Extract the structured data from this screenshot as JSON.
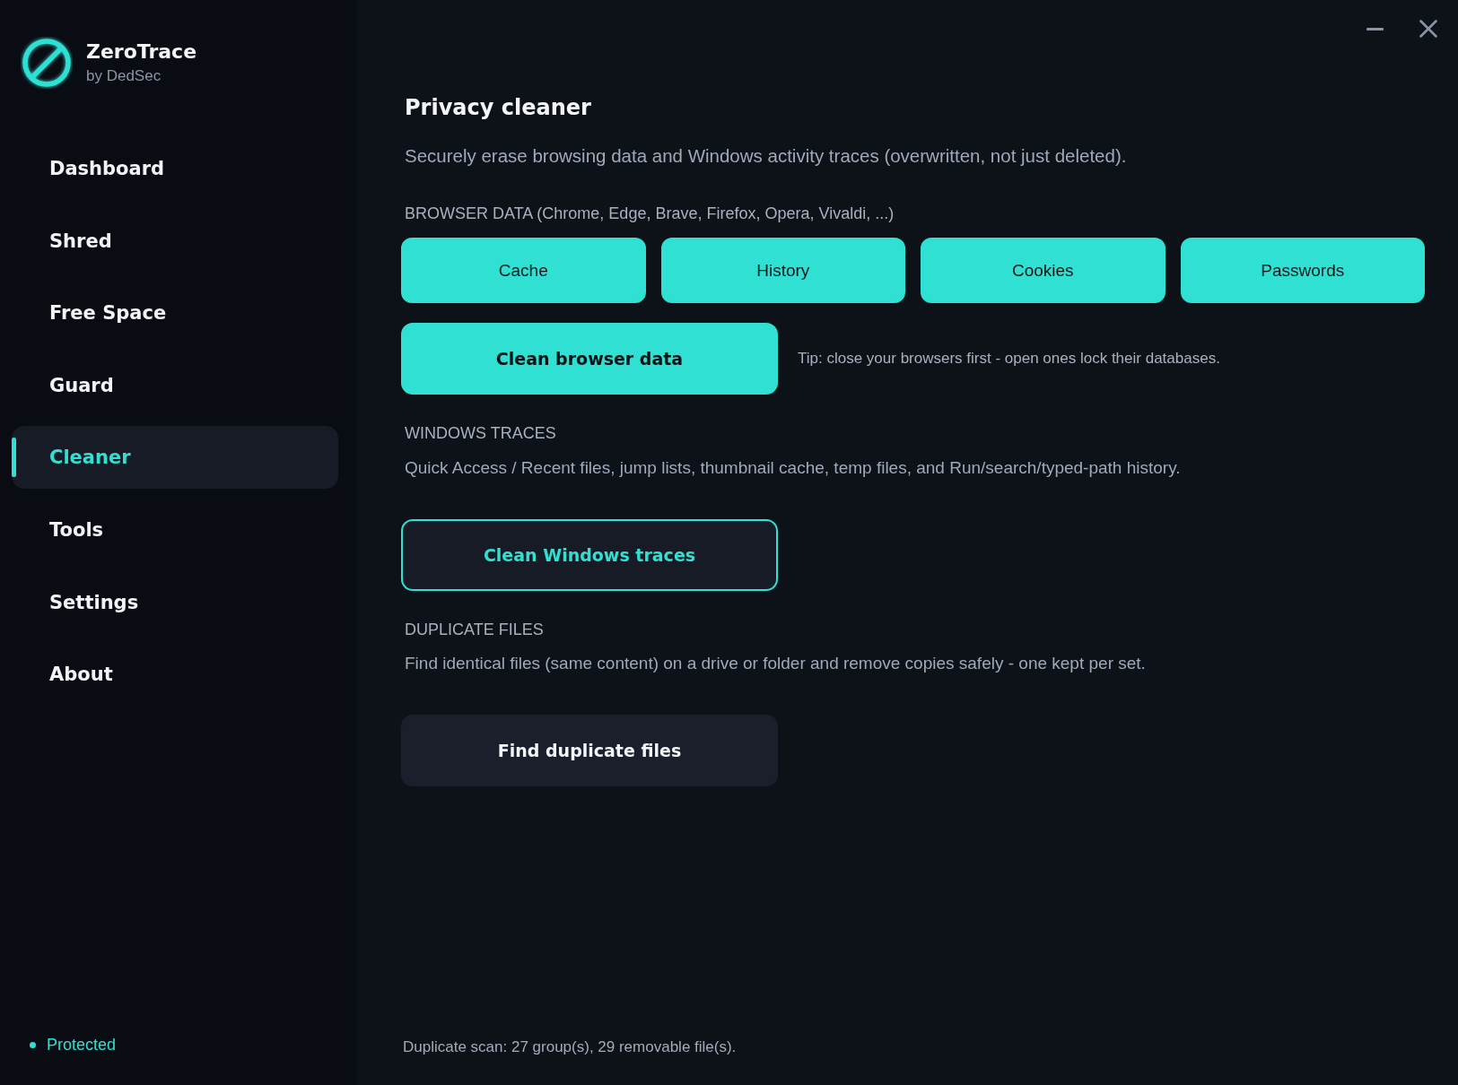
{
  "app": {
    "name": "ZeroTrace",
    "byline": "by DedSec"
  },
  "sidebar": {
    "items": [
      {
        "label": "Dashboard",
        "selected": false
      },
      {
        "label": "Shred",
        "selected": false
      },
      {
        "label": "Free Space",
        "selected": false
      },
      {
        "label": "Guard",
        "selected": false
      },
      {
        "label": "Cleaner",
        "selected": true
      },
      {
        "label": "Tools",
        "selected": false
      },
      {
        "label": "Settings",
        "selected": false
      },
      {
        "label": "About",
        "selected": false
      }
    ],
    "status": "Protected"
  },
  "page": {
    "title": "Privacy cleaner",
    "subtitle": "Securely erase browsing data and Windows activity traces (overwritten, not just deleted)."
  },
  "sections": [
    {
      "heading": "BROWSER DATA (Chrome, Edge, Brave, Firefox, Opera, Vivaldi, ...)",
      "options": [
        {
          "label": "Cache",
          "selected": true
        },
        {
          "label": "History",
          "selected": true
        },
        {
          "label": "Cookies",
          "selected": true
        },
        {
          "label": "Passwords",
          "selected": true
        }
      ],
      "action": {
        "label": "Clean browser data",
        "kind": "primary"
      },
      "tip": "Tip: close your browsers first - open ones lock their databases."
    },
    {
      "heading": "WINDOWS TRACES",
      "description": "Quick Access / Recent files, jump lists, thumbnail cache, temp files, and Run/search/typed-path history.",
      "action": {
        "label": "Clean Windows traces",
        "kind": "outline"
      }
    },
    {
      "heading": "DUPLICATE FILES",
      "description": "Find identical files (same content) on a drive or folder and remove copies safely - one kept per set.",
      "action": {
        "label": "Find duplicate files",
        "kind": "secondary"
      }
    }
  ],
  "status_bar": {
    "text": "Duplicate scan: 27 group(s), 29 removable file(s)."
  }
}
